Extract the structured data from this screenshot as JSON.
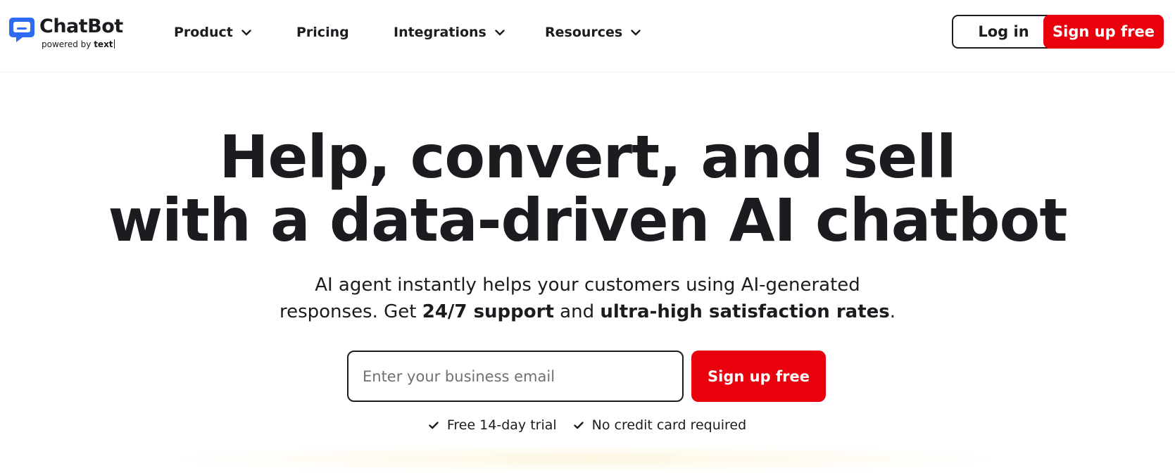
{
  "brand": {
    "name": "ChatBot",
    "powered_prefix": "powered by",
    "powered_brand": "text",
    "icon": "chat-bubble-icon",
    "color": "#2f6bf2"
  },
  "nav": {
    "items": [
      {
        "label": "Product",
        "dropdown": true
      },
      {
        "label": "Pricing",
        "dropdown": false
      },
      {
        "label": "Integrations",
        "dropdown": true
      },
      {
        "label": "Resources",
        "dropdown": true
      }
    ],
    "login_label": "Log in",
    "signup_label": "Sign up free"
  },
  "hero": {
    "title_line1": "Help, convert, and sell",
    "title_line2": "with a data-driven AI chatbot",
    "subtitle_line1": "AI agent instantly helps your customers using AI-generated",
    "subtitle_line2_a": "responses. Get ",
    "subtitle_line2_b": "24/7 support",
    "subtitle_line2_c": " and ",
    "subtitle_line2_d": "ultra-high satisfaction rates",
    "subtitle_line2_e": ".",
    "email_placeholder": "Enter your business email",
    "email_value": "",
    "signup_label": "Sign up free",
    "perks": [
      "Free 14-day trial",
      "No credit card required"
    ]
  },
  "colors": {
    "accent_red": "#e8000d",
    "text": "#1b1b20",
    "brand_blue": "#2f6bf2"
  }
}
